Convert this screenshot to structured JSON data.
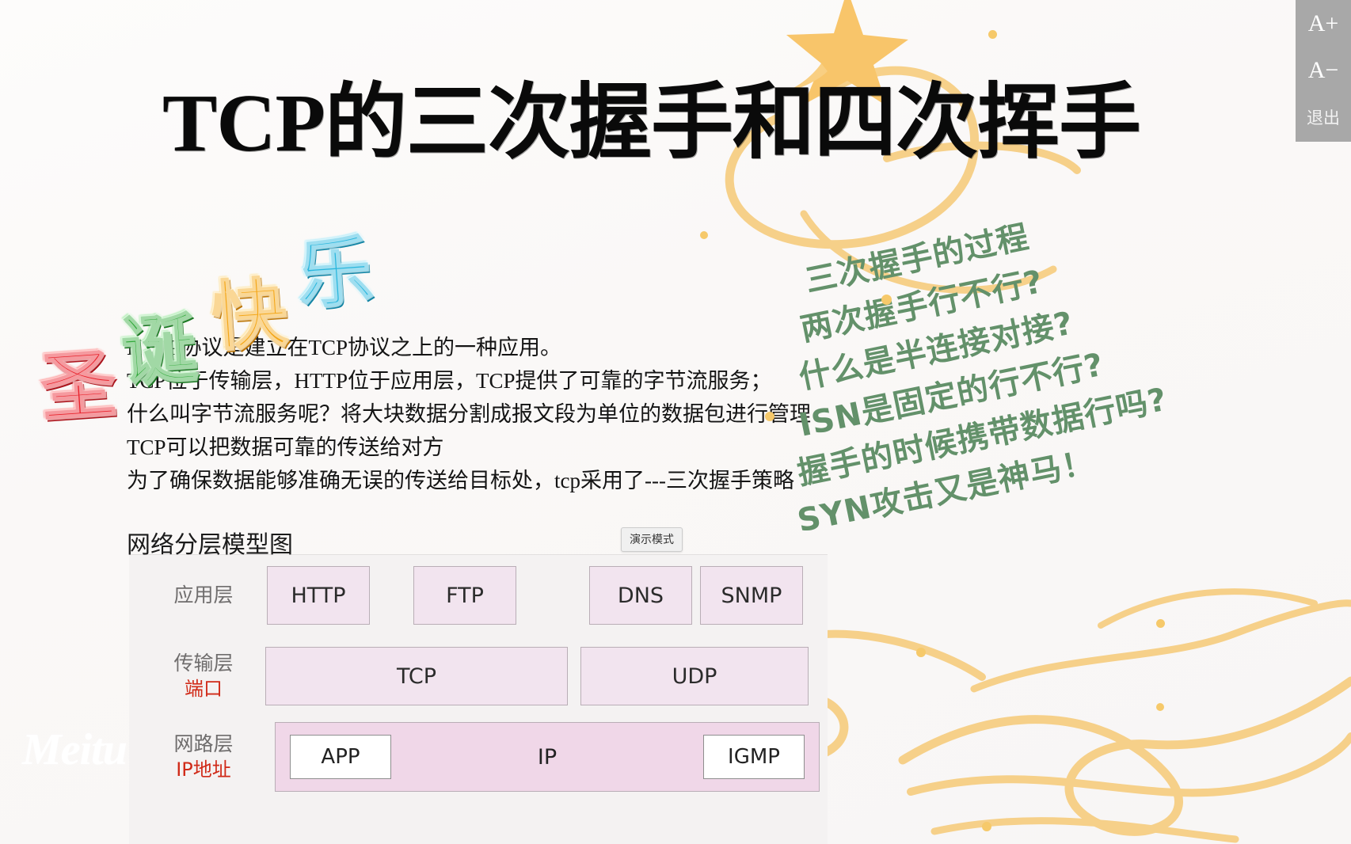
{
  "title": "TCP的三次握手和四次挥手",
  "greeting": {
    "full": "圣诞快乐",
    "chars": [
      "圣",
      "诞",
      "快",
      "乐"
    ],
    "colors": [
      "#e8202a",
      "#2fa838",
      "#f4a616",
      "#29b6dd"
    ]
  },
  "body_lines": [
    "HTTP协议是建立在TCP协议之上的一种应用。",
    "TCP位于传输层，HTTP位于应用层，TCP提供了可靠的字节流服务；",
    "什么叫字节流服务呢？将大块数据分割成报文段为单位的数据包进行管理",
    "TCP可以把数据可靠的传送给对方",
    "为了确保数据能够准确无误的传送给目标处，tcp采用了---三次握手策略"
  ],
  "questions": [
    "三次握手的过程",
    "两次握手行不行?",
    "什么是半连接对接?",
    "ISN是固定的行不行?",
    "握手的时候携带数据行吗?",
    "SYN攻击又是神马！"
  ],
  "questions_color": "#63916a",
  "diagram": {
    "heading": "网络分层模型图",
    "demo_badge": "演示模式",
    "rows": [
      {
        "label": "应用层",
        "sub": "",
        "cells": [
          "HTTP",
          "FTP",
          "DNS",
          "SNMP"
        ]
      },
      {
        "label": "传输层",
        "sub": "端口",
        "cells": [
          "TCP",
          "UDP"
        ]
      },
      {
        "label": "网路层",
        "sub": "IP地址",
        "cells": [
          "APP",
          "IP",
          "IGMP"
        ]
      }
    ],
    "sub_color": "#d02a18",
    "cell_fill": "#f2e4ef"
  },
  "toolbar": {
    "zoom_in": "A+",
    "zoom_out": "A−",
    "exit": "退出",
    "background": "#a8a8a8"
  },
  "watermark": "Meitu"
}
